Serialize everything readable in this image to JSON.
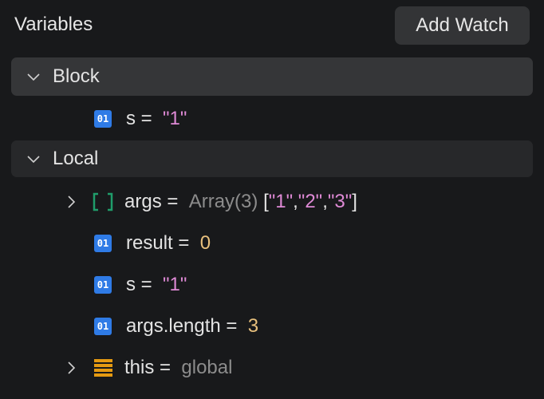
{
  "header": {
    "title": "Variables",
    "add_watch_label": "Add Watch"
  },
  "sections": [
    {
      "label": "Block",
      "expanded": true,
      "variables": [
        {
          "name": "s",
          "eq": "=",
          "value": "\"1\"",
          "type": "string",
          "icon": "primitive-icon",
          "icon_text": "01"
        }
      ]
    },
    {
      "label": "Local",
      "expanded": true,
      "variables": [
        {
          "name": "args",
          "eq": "=",
          "type_label": "Array(3)",
          "preview": {
            "open": "[",
            "items": [
              "\"1\"",
              "\"2\"",
              "\"3\""
            ],
            "sep": ",",
            "close": "]"
          },
          "icon": "array-icon",
          "expandable": true
        },
        {
          "name": "result",
          "eq": "=",
          "value": "0",
          "type": "number",
          "icon_text": "01"
        },
        {
          "name": "s",
          "eq": "=",
          "value": "\"1\"",
          "type": "string",
          "icon_text": "01"
        },
        {
          "name": "args.length",
          "eq": "=",
          "value": "3",
          "type": "number",
          "icon_text": "01"
        },
        {
          "name": "this",
          "eq": "=",
          "value": "global",
          "type": "object",
          "icon": "object-icon",
          "expandable": true
        }
      ]
    }
  ],
  "colors": {
    "string": "#df8ad6",
    "number": "#e8c07d",
    "badge": "#2f7be6",
    "array_icon": "#1f9d6b",
    "object_icon": "#e59a12"
  }
}
